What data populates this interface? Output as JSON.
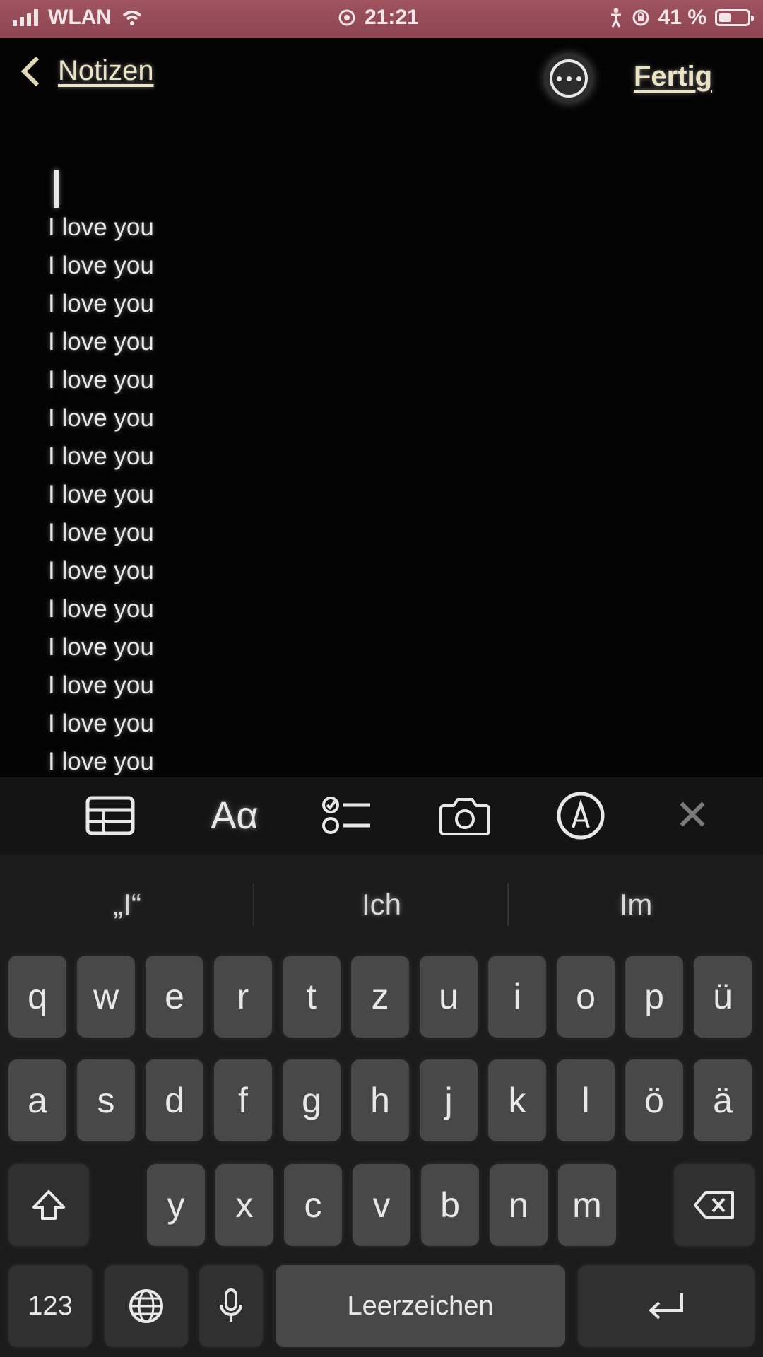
{
  "status_bar": {
    "carrier": "WLAN",
    "time": "21:21",
    "battery_percent": "41 %",
    "battery_level": 0.41
  },
  "nav": {
    "back_label": "Notizen",
    "done_label": "Fertig"
  },
  "note": {
    "lines": [
      "I love you",
      "I love you",
      "I love you",
      "I love you",
      "I love you",
      "I love you",
      "I love you",
      "I love you",
      "I love you",
      "I love you",
      "I love you",
      "I love you",
      "I love you",
      "I love you",
      "I love you"
    ]
  },
  "toolbar": {
    "icons": [
      "table-icon",
      "text-format-icon",
      "checklist-icon",
      "camera-icon",
      "markup-icon",
      "close-icon"
    ],
    "format_label": "Aα"
  },
  "keyboard": {
    "predictions": [
      "„I“",
      "Ich",
      "Im"
    ],
    "row1": [
      "q",
      "w",
      "e",
      "r",
      "t",
      "z",
      "u",
      "i",
      "o",
      "p",
      "ü"
    ],
    "row2": [
      "a",
      "s",
      "d",
      "f",
      "g",
      "h",
      "j",
      "k",
      "l",
      "ö",
      "ä"
    ],
    "row3": [
      "y",
      "x",
      "c",
      "v",
      "b",
      "n",
      "m"
    ],
    "numbers_key": "123",
    "space_key": "Leerzeichen"
  }
}
